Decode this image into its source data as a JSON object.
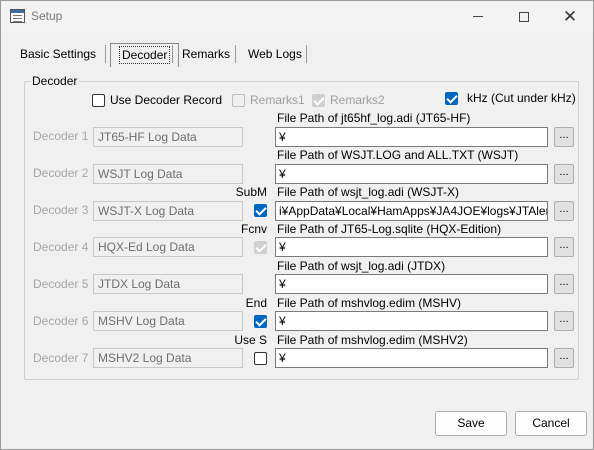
{
  "window": {
    "title": "Setup",
    "icon": "app-settings-icon"
  },
  "title_buttons": {
    "minimize": "minimize-icon",
    "maximize": "maximize-icon",
    "close": "close-icon"
  },
  "tabs": [
    {
      "label": "Basic Settings",
      "active": false
    },
    {
      "label": "Decoder",
      "active": true
    },
    {
      "label": "Remarks",
      "active": false
    },
    {
      "label": "Web Logs",
      "active": false
    }
  ],
  "decoder_group": {
    "legend": "Decoder",
    "options": {
      "use_decoder_record": {
        "label": "Use Decoder Record",
        "checked": false
      },
      "remarks1": {
        "label": "Remarks1",
        "checked": false,
        "enabled": false
      },
      "remarks2": {
        "label": "Remarks2",
        "checked": true,
        "enabled": false
      },
      "khz": {
        "label": "kHz (Cut under kHz)",
        "checked": true
      }
    },
    "rows": [
      {
        "label": "Decoder 1",
        "name": "JT65-HF Log Data",
        "side_label": "",
        "path_caption": "File Path of jt65hf_log.adi (JT65-HF)",
        "path_value": "¥",
        "browse": "..."
      },
      {
        "label": "Decoder 2",
        "name": "WSJT Log Data",
        "side_label": "",
        "path_caption": "File Path of WSJT.LOG and ALL.TXT (WSJT)",
        "path_value": "¥",
        "browse": "..."
      },
      {
        "label": "Decoder 3",
        "name": "WSJT-X Log Data",
        "side_label": "SubM",
        "path_caption": "File Path of wsjt_log.adi (WSJT-X)",
        "path_value": "i¥AppData¥Local¥HamApps¥JA4JOE¥logs¥JTAlertX",
        "browse": "..."
      },
      {
        "label": "Decoder 4",
        "name": "HQX-Ed Log Data",
        "side_label": "Fcnv",
        "path_caption": "File Path of JT65-Log.sqlite (HQX-Edition)",
        "path_value": "¥",
        "browse": "..."
      },
      {
        "label": "Decoder 5",
        "name": "JTDX Log Data",
        "side_label": "",
        "path_caption": "File Path of wsjt_log.adi (JTDX)",
        "path_value": "¥",
        "browse": "..."
      },
      {
        "label": "Decoder 6",
        "name": "MSHV Log Data",
        "side_label": "End",
        "path_caption": "File Path of mshvlog.edim (MSHV)",
        "path_value": "¥",
        "browse": "..."
      },
      {
        "label": "Decoder 7",
        "name": "MSHV2 Log Data",
        "side_label": "Use S",
        "path_caption": "File Path of mshvlog.edim (MSHV2)",
        "path_value": "¥",
        "browse": "..."
      }
    ],
    "row_checks": {
      "3": true,
      "4": true,
      "6": true,
      "7": false
    }
  },
  "footer": {
    "save_label": "Save",
    "cancel_label": "Cancel"
  }
}
